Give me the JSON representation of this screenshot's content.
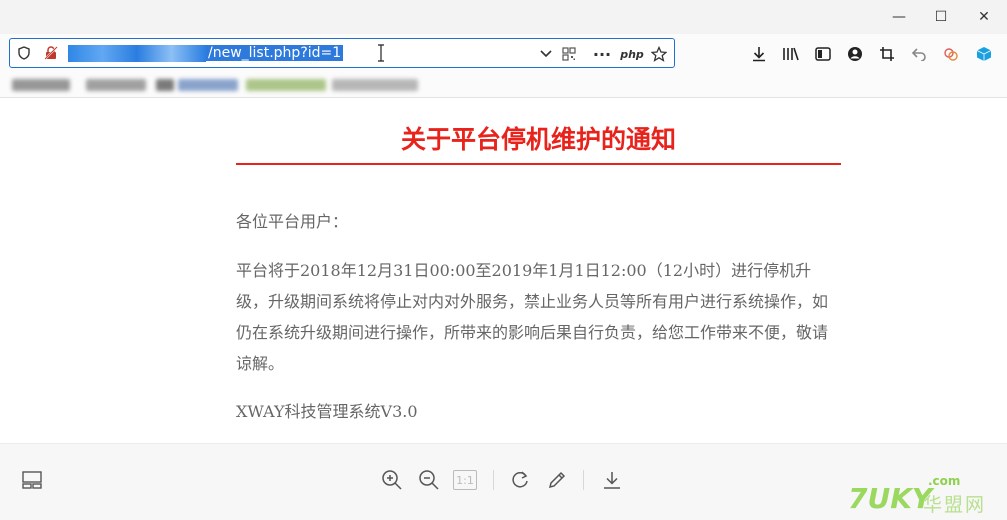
{
  "window": {
    "minimize": "—",
    "maximize": "☐",
    "close": "✕"
  },
  "urlbar": {
    "url_visible": "/new_list.php?id=1",
    "php_label": "php"
  },
  "page": {
    "title": "关于平台停机维护的通知",
    "greeting": "各位平台用户：",
    "body": "平台将于2018年12月31日00:00至2019年1月1日12:00（12小时）进行停机升级，升级期间系统将停止对内对外服务，禁止业务人员等所有用户进行系统操作，如仍在系统升级期间进行操作，所带来的影响后果自行负责，给您工作带来不便，敬请谅解。",
    "signature": "XWAY科技管理系统V3.0"
  },
  "viewer": {
    "actual_size_label": "1:1"
  },
  "watermark": {
    "logo": "7UKY",
    "dotcom": ".com",
    "cn": "华盟网"
  },
  "colors": {
    "title_red": "#e8231c",
    "url_border": "#1f6fd1",
    "selection": "#2d79dc"
  }
}
